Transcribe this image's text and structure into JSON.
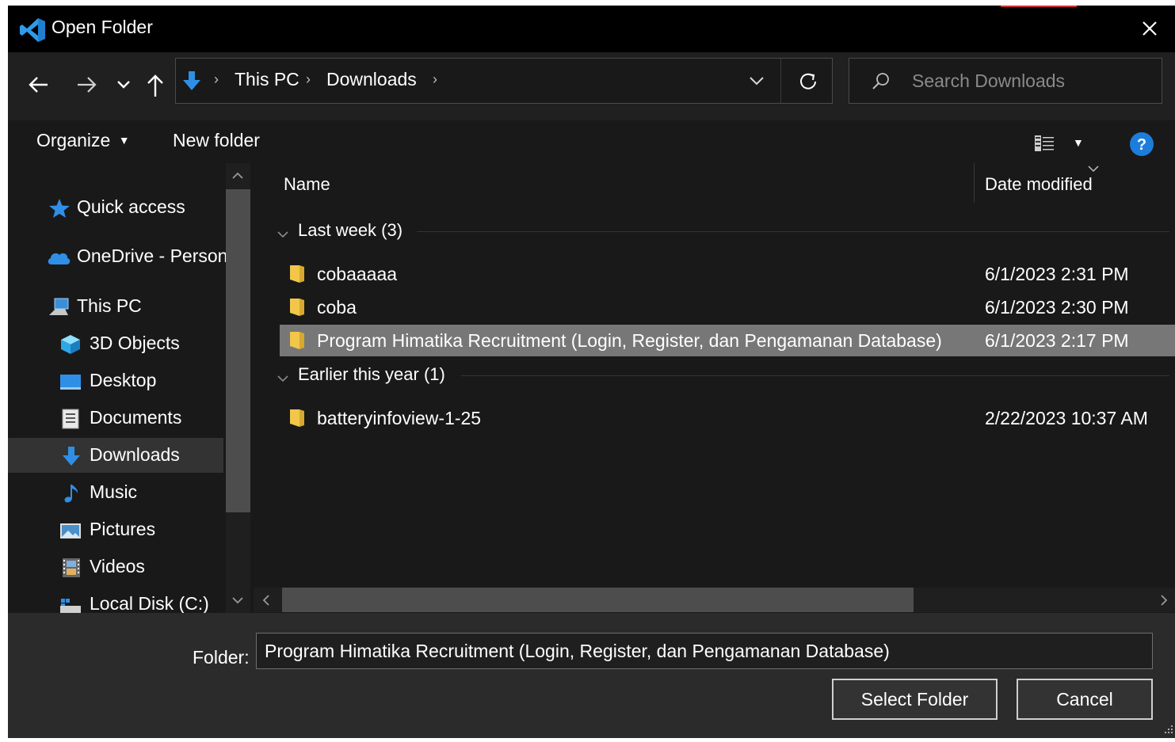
{
  "window": {
    "title": "Open Folder",
    "accent_color": "#d42f2f"
  },
  "nav": {
    "breadcrumb": [
      "This PC",
      "Downloads"
    ],
    "search_placeholder": "Search Downloads"
  },
  "toolbar": {
    "organize_label": "Organize",
    "new_folder_label": "New folder"
  },
  "sidebar": {
    "items": [
      {
        "label": "Quick access",
        "icon": "star-icon"
      },
      {
        "label": "OneDrive - Person",
        "icon": "cloud-icon"
      },
      {
        "label": "This PC",
        "icon": "computer-icon"
      },
      {
        "label": "3D Objects",
        "icon": "cube-icon"
      },
      {
        "label": "Desktop",
        "icon": "desktop-icon"
      },
      {
        "label": "Documents",
        "icon": "document-icon"
      },
      {
        "label": "Downloads",
        "icon": "download-arrow-icon",
        "selected": true
      },
      {
        "label": "Music",
        "icon": "music-note-icon"
      },
      {
        "label": "Pictures",
        "icon": "picture-icon"
      },
      {
        "label": "Videos",
        "icon": "film-icon"
      },
      {
        "label": "Local Disk (C:)",
        "icon": "drive-icon"
      }
    ]
  },
  "columns": {
    "name": "Name",
    "date_modified": "Date modified"
  },
  "groups": [
    {
      "label": "Last week (3)",
      "files": [
        {
          "name": "cobaaaaa",
          "date": "6/1/2023 2:31 PM"
        },
        {
          "name": "coba",
          "date": "6/1/2023 2:30 PM"
        },
        {
          "name": "Program Himatika Recruitment (Login, Register, dan Pengamanan Database)",
          "date": "6/1/2023 2:17 PM",
          "selected": true
        }
      ]
    },
    {
      "label": "Earlier this year (1)",
      "files": [
        {
          "name": "batteryinfoview-1-25",
          "date": "2/22/2023 10:37 AM"
        }
      ]
    }
  ],
  "footer": {
    "folder_label": "Folder:",
    "folder_value": "Program Himatika Recruitment (Login, Register, dan Pengamanan Database)",
    "select_label": "Select Folder",
    "cancel_label": "Cancel"
  }
}
